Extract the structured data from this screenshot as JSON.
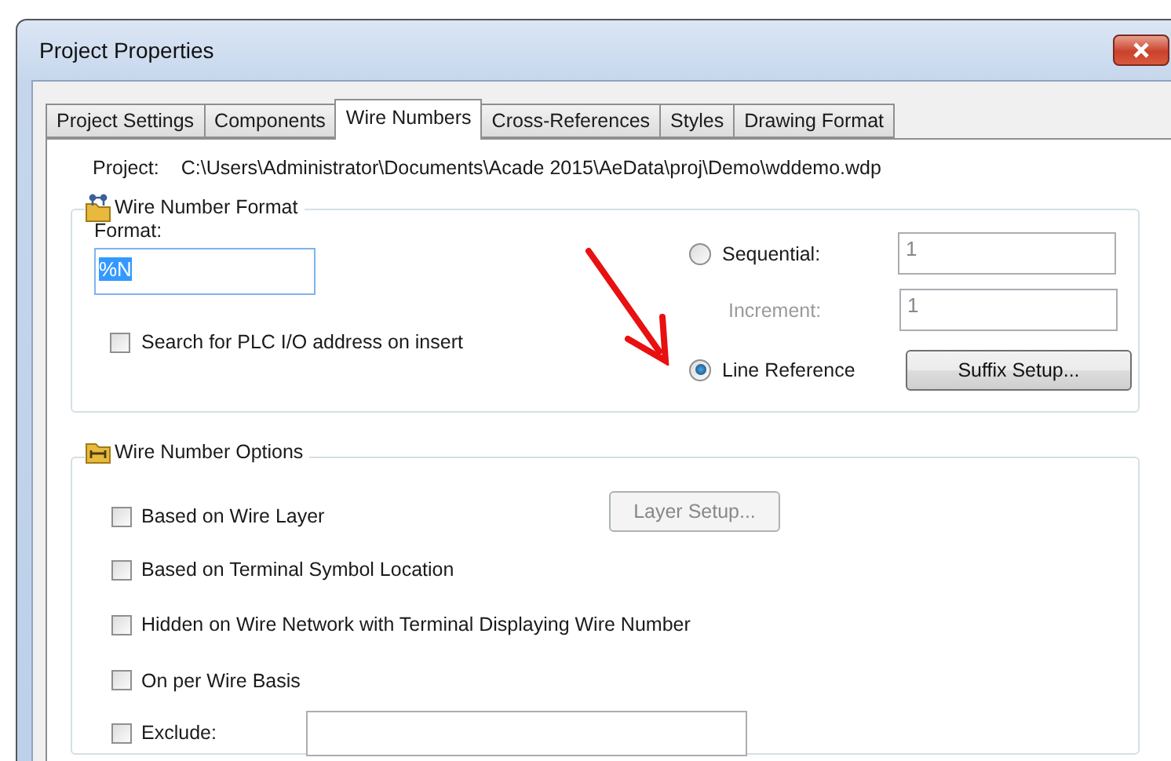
{
  "window": {
    "title": "Project Properties"
  },
  "tabs": [
    {
      "label": "Project Settings",
      "selected": false
    },
    {
      "label": "Components",
      "selected": false
    },
    {
      "label": "Wire Numbers",
      "selected": true
    },
    {
      "label": "Cross-References",
      "selected": false
    },
    {
      "label": "Styles",
      "selected": false
    },
    {
      "label": "Drawing Format",
      "selected": false
    }
  ],
  "project": {
    "label": "Project:",
    "path": "C:\\Users\\Administrator\\Documents\\Acade 2015\\AeData\\proj\\Demo\\wddemo.wdp"
  },
  "wire_number_format": {
    "title": "Wire Number Format",
    "format_label": "Format:",
    "format_value": "%N",
    "plc_search": {
      "label": "Search for PLC I/O address on insert",
      "checked": false
    },
    "modes": [
      {
        "label": "Sequential:",
        "selected": false
      },
      {
        "label": "Line Reference",
        "selected": true
      }
    ],
    "start_value": "1",
    "increment": {
      "label": "Increment:",
      "value": "1",
      "disabled": true
    },
    "suffix_button": "Suffix Setup..."
  },
  "wire_number_options": {
    "title": "Wire Number Options",
    "items": [
      {
        "kind": "button",
        "label": "Based on Wire Layer",
        "checked": false,
        "button": "Layer Setup...",
        "button_disabled": true
      },
      {
        "kind": "plain",
        "label": "Based on Terminal Symbol Location",
        "checked": false
      },
      {
        "kind": "plain",
        "label": "Hidden on Wire Network with Terminal Displaying Wire Number",
        "checked": false
      },
      {
        "kind": "plain",
        "label": "On per Wire Basis",
        "checked": false
      },
      {
        "kind": "field",
        "label": "Exclude:",
        "checked": false
      }
    ]
  }
}
